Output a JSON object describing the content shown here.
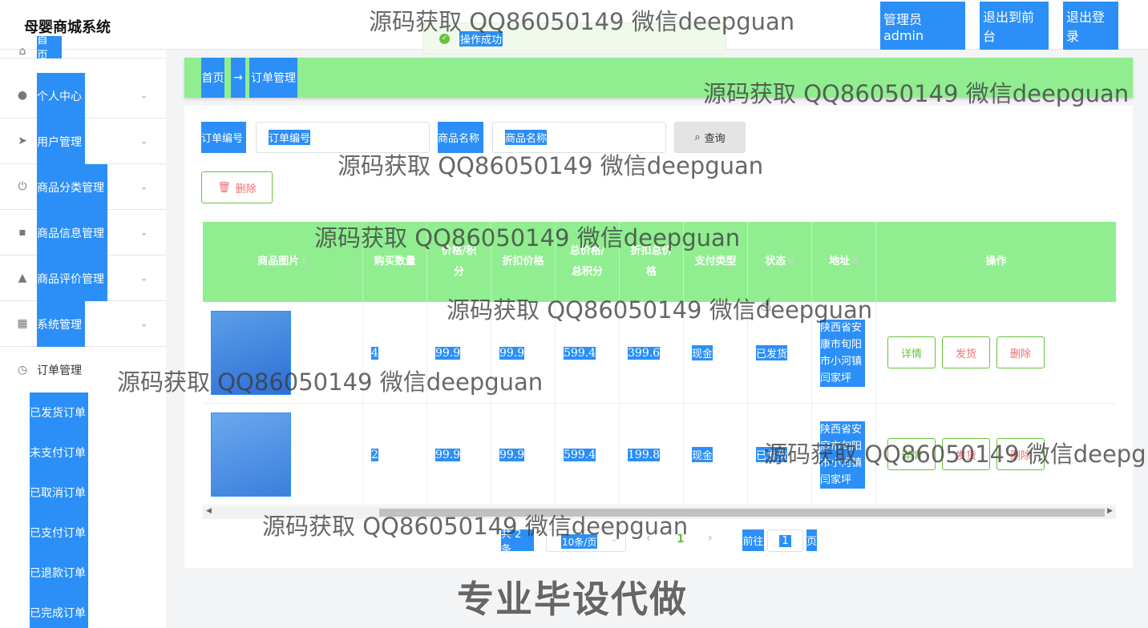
{
  "header": {
    "app_title": "母婴商城系统",
    "admin_label": "管理员 admin",
    "exit_front_label": "退出到前台",
    "logout_label": "退出登录"
  },
  "toast": {
    "message": "操作成功"
  },
  "sidebar": {
    "items": [
      {
        "label": "首页",
        "icon": "home-icon"
      },
      {
        "label": "个人中心",
        "icon": "user-icon"
      },
      {
        "label": "用户管理",
        "icon": "send-icon"
      },
      {
        "label": "商品分类管理",
        "icon": "power-icon"
      },
      {
        "label": "商品信息管理",
        "icon": "chat-icon"
      },
      {
        "label": "商品评价管理",
        "icon": "person-icon"
      },
      {
        "label": "系统管理",
        "icon": "grid-icon"
      },
      {
        "label": "订单管理",
        "icon": "clock-icon"
      }
    ],
    "order_subitems": [
      "已发货订单",
      "未支付订单",
      "已取消订单",
      "已支付订单",
      "已退款订单",
      "已完成订单"
    ]
  },
  "breadcrumb": {
    "home": "首页",
    "separator": "→",
    "current": "订单管理"
  },
  "search": {
    "order_no_label": "订单编号",
    "order_no_placeholder": "订单编号",
    "product_name_label": "商品名称",
    "product_name_placeholder": "商品名称",
    "query_label": "查询",
    "delete_label": "删除"
  },
  "table": {
    "headers": [
      "商品图片",
      "购买数量",
      "价格/积分",
      "折扣价格",
      "总价格/总积分",
      "折扣总价格",
      "支付类型",
      "状态",
      "地址",
      "操作"
    ],
    "rows": [
      {
        "quantity": "4",
        "price": "99.9",
        "discount_price": "99.9",
        "total_price": "599.4",
        "discount_total": "399.6",
        "payment": "现金",
        "status": "已发货",
        "address": "陕西省安康市旬阳市小河镇闫家坪"
      },
      {
        "quantity": "2",
        "price": "99.9",
        "discount_price": "99.9",
        "total_price": "599.4",
        "discount_total": "199.8",
        "payment": "现金",
        "status": "已发货",
        "address": "陕西省安康市旬阳市小河镇闫家坪"
      }
    ],
    "actions": {
      "detail": "详情",
      "ship": "发货",
      "delete": "删除"
    }
  },
  "pagination": {
    "total": "共 2 条",
    "page_size": "10条/页",
    "current_page": "1",
    "goto_prefix": "前往",
    "goto_value": "1",
    "goto_suffix": "页"
  },
  "watermarks": {
    "text": "源码获取 QQ86050149 微信deepguan",
    "promo": "专业毕设代做"
  },
  "colors": {
    "accent": "#2b8ff7",
    "header_green": "#90ee90",
    "success": "#67c23a",
    "danger": "#f56c6c"
  }
}
